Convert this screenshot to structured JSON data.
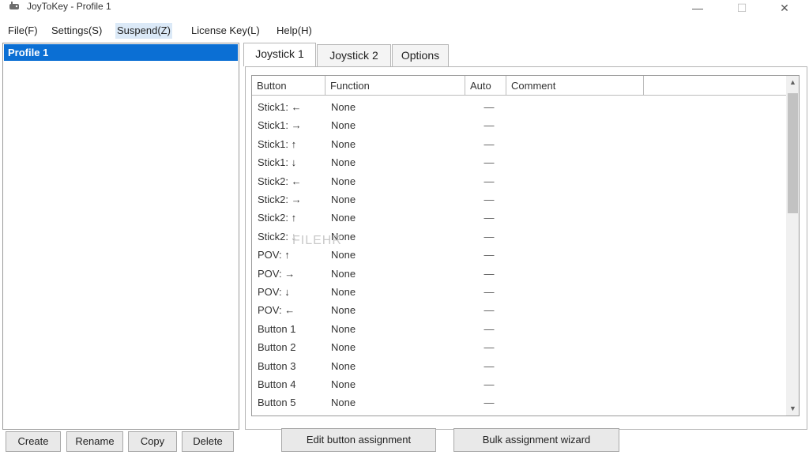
{
  "window": {
    "title": "JoyToKey - Profile 1",
    "controls": {
      "minimize": "—",
      "maximize": "☐",
      "close": "✕"
    }
  },
  "menu": [
    {
      "label": "File(F)"
    },
    {
      "label": "Settings(S)"
    },
    {
      "label": "Suspend(Z)"
    },
    {
      "label": "License Key(L)"
    },
    {
      "label": "Help(H)"
    }
  ],
  "profiles": {
    "selected": "Profile 1",
    "buttons": {
      "create": "Create",
      "rename": "Rename",
      "copy": "Copy",
      "delete": "Delete"
    }
  },
  "tabs": [
    {
      "label": "Joystick 1"
    },
    {
      "label": "Joystick 2"
    },
    {
      "label": "Options"
    }
  ],
  "table": {
    "columns": {
      "button": "Button",
      "function": "Function",
      "auto": "Auto",
      "comment": "Comment"
    },
    "rows": [
      {
        "button": "Stick1: ←",
        "function": "None",
        "auto": "—",
        "comment": ""
      },
      {
        "button": "Stick1: →",
        "function": "None",
        "auto": "—",
        "comment": ""
      },
      {
        "button": "Stick1: ↑",
        "function": "None",
        "auto": "—",
        "comment": ""
      },
      {
        "button": "Stick1: ↓",
        "function": "None",
        "auto": "—",
        "comment": ""
      },
      {
        "button": "Stick2: ←",
        "function": "None",
        "auto": "—",
        "comment": ""
      },
      {
        "button": "Stick2: →",
        "function": "None",
        "auto": "—",
        "comment": ""
      },
      {
        "button": "Stick2: ↑",
        "function": "None",
        "auto": "—",
        "comment": ""
      },
      {
        "button": "Stick2: ↓",
        "function": "None",
        "auto": "—",
        "comment": ""
      },
      {
        "button": "POV: ↑",
        "function": "None",
        "auto": "—",
        "comment": ""
      },
      {
        "button": "POV: →",
        "function": "None",
        "auto": "—",
        "comment": ""
      },
      {
        "button": "POV: ↓",
        "function": "None",
        "auto": "—",
        "comment": ""
      },
      {
        "button": "POV: ←",
        "function": "None",
        "auto": "—",
        "comment": ""
      },
      {
        "button": "Button 1",
        "function": "None",
        "auto": "—",
        "comment": ""
      },
      {
        "button": "Button 2",
        "function": "None",
        "auto": "—",
        "comment": ""
      },
      {
        "button": "Button 3",
        "function": "None",
        "auto": "—",
        "comment": ""
      },
      {
        "button": "Button 4",
        "function": "None",
        "auto": "—",
        "comment": ""
      },
      {
        "button": "Button 5",
        "function": "None",
        "auto": "—",
        "comment": ""
      }
    ]
  },
  "actions": {
    "edit": "Edit button assignment",
    "bulk": "Bulk assignment wizard"
  },
  "scrollbar": {
    "up_arrow": "▲",
    "down_arrow": "▼"
  },
  "watermark": "FILEHR",
  "colors": {
    "selection": "#0b6fd4",
    "active_menu": "#dbe9f7"
  }
}
